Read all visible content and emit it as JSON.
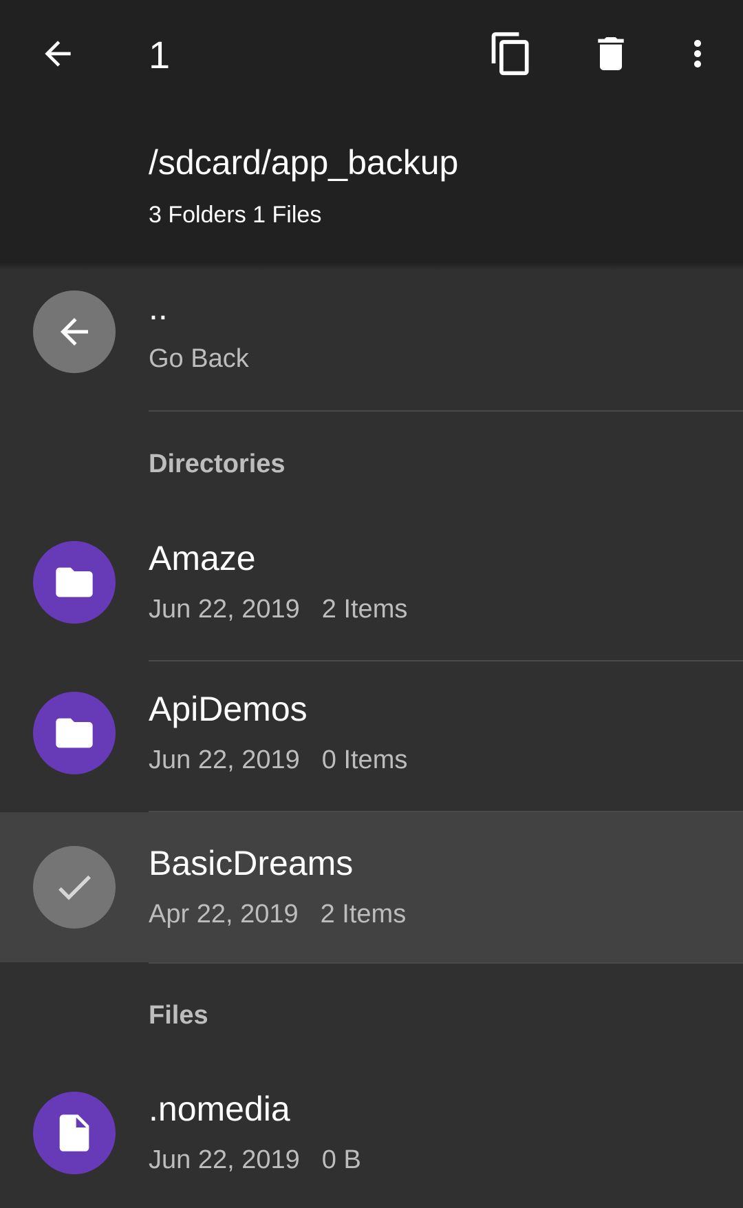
{
  "toolbar": {
    "selected_count": "1",
    "back_icon": "arrow-back-icon",
    "copy_icon": "copy-icon",
    "delete_icon": "delete-icon",
    "more_icon": "more-vert-icon"
  },
  "header": {
    "path": "/sdcard/app_backup",
    "summary": "3 Folders 1 Files"
  },
  "go_back": {
    "title": "..",
    "subtitle": "Go Back"
  },
  "sections": {
    "directories": "Directories",
    "files": "Files"
  },
  "directories": [
    {
      "name": "Amaze",
      "date": "Jun 22, 2019",
      "items": "2 Items",
      "selected": false
    },
    {
      "name": "ApiDemos",
      "date": "Jun 22, 2019",
      "items": "0 Items",
      "selected": false
    },
    {
      "name": "BasicDreams",
      "date": "Apr 22, 2019",
      "items": "2 Items",
      "selected": true
    }
  ],
  "files": [
    {
      "name": ".nomedia",
      "date": "Jun 22, 2019",
      "size": "0 B"
    }
  ],
  "colors": {
    "app_bar": "#212121",
    "background": "#303030",
    "selected_row": "#424242",
    "accent": "#673ab7",
    "grey_avatar": "#757575"
  }
}
